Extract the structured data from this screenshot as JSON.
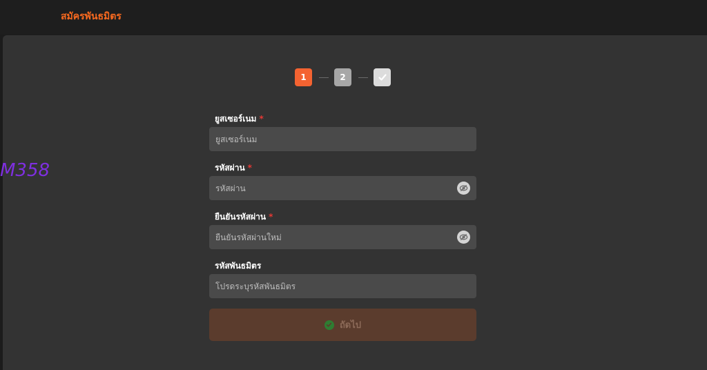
{
  "header": {
    "title": "สมัครพันธมิตร"
  },
  "brand": {
    "logo_text": "M358"
  },
  "stepper": {
    "step1": "1",
    "step2": "2",
    "step3_icon": "check-icon"
  },
  "form": {
    "username": {
      "label": "ยูสเซอร์เนม",
      "required": "*",
      "placeholder": "ยูสเซอร์เนม"
    },
    "password": {
      "label": "รหัสผ่าน",
      "required": "*",
      "placeholder": "รหัสผ่าน"
    },
    "confirm_password": {
      "label": "ยืนยันรหัสผ่าน",
      "required": "*",
      "placeholder": "ยืนยันรหัสผ่านใหม่"
    },
    "partner_code": {
      "label": "รหัสพันธมิตร",
      "placeholder": "โปรดระบุรหัสพันธมิตร"
    },
    "next_label": "ถัดไป"
  },
  "colors": {
    "accent": "#f7691f",
    "brand": "#7f2fe0",
    "required": "#e53935",
    "button_bg": "#5b3c2d"
  }
}
